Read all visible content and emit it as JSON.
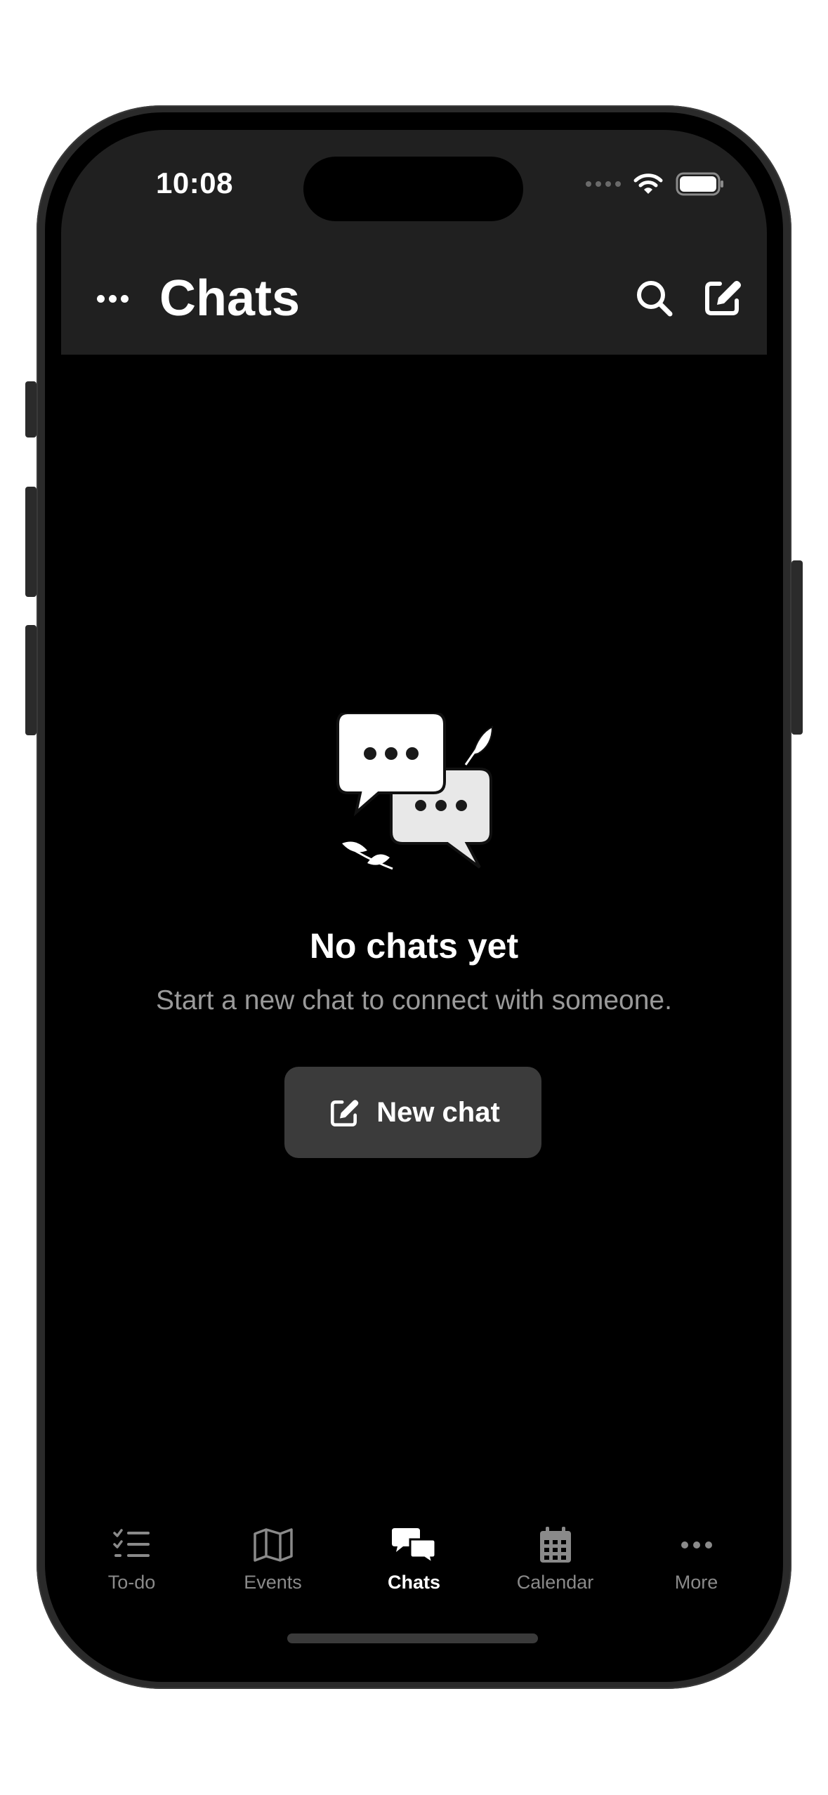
{
  "status_bar": {
    "time": "10:08"
  },
  "header": {
    "title": "Chats"
  },
  "empty_state": {
    "title": "No chats yet",
    "subtitle": "Start a new chat to connect with someone.",
    "button_label": "New chat"
  },
  "tabs": [
    {
      "label": "To-do",
      "icon": "checklist-icon",
      "active": false
    },
    {
      "label": "Events",
      "icon": "map-icon",
      "active": false
    },
    {
      "label": "Chats",
      "icon": "chat-bubbles-icon",
      "active": true
    },
    {
      "label": "Calendar",
      "icon": "calendar-icon",
      "active": false
    },
    {
      "label": "More",
      "icon": "ellipsis-icon",
      "active": false
    }
  ],
  "colors": {
    "background": "#000000",
    "header_bg": "#202020",
    "button_bg": "#3b3b3b",
    "active_tab": "#ffffff",
    "inactive_tab": "#8a8a8a"
  }
}
